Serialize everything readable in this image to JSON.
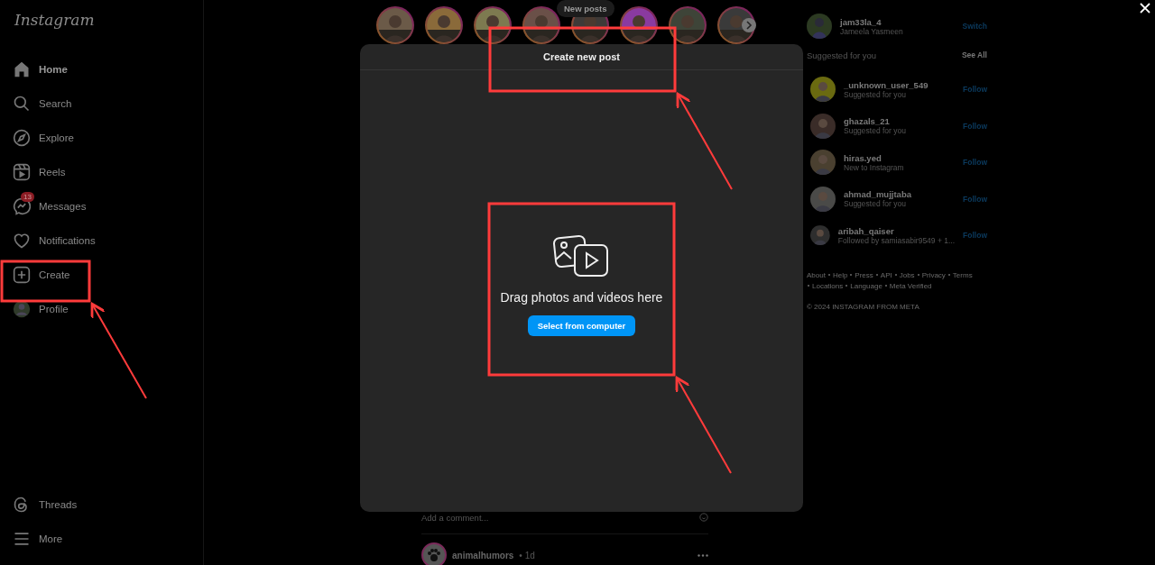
{
  "sidebar": {
    "logo": "Instagram",
    "items": [
      {
        "kind": "home",
        "label": "Home",
        "selected": true
      },
      {
        "kind": "search",
        "label": "Search",
        "selected": false
      },
      {
        "kind": "explore",
        "label": "Explore",
        "selected": false
      },
      {
        "kind": "reels",
        "label": "Reels",
        "selected": false
      },
      {
        "kind": "messages",
        "label": "Messages",
        "selected": false,
        "badge": "13"
      },
      {
        "kind": "notifications",
        "label": "Notifications",
        "selected": false
      },
      {
        "kind": "create",
        "label": "Create",
        "selected": false
      },
      {
        "kind": "profile",
        "label": "Profile",
        "selected": false
      }
    ],
    "bottom_items": [
      {
        "kind": "threads",
        "label": "Threads"
      },
      {
        "kind": "more",
        "label": "More"
      }
    ]
  },
  "feed": {
    "new_posts": "New posts",
    "comment": {
      "placeholder": "Add a comment..."
    },
    "post": {
      "author": "animalhumors",
      "time": "• 1d"
    }
  },
  "account": {
    "username": "jam33la_4",
    "name": "Jameela Yasmeen",
    "action": "Switch"
  },
  "suggestions": {
    "title": "Suggested for you",
    "see_all": "See All",
    "users": [
      {
        "username": "_unknown_user_549",
        "note": "Suggested for you",
        "action": "Follow"
      },
      {
        "username": "ghazals_21",
        "note": "Suggested for you",
        "action": "Follow"
      },
      {
        "username": "hiras.yed",
        "note": "New to Instagram",
        "action": "Follow"
      },
      {
        "username": "ahmad_mujjtaba",
        "note": "Suggested for you",
        "action": "Follow"
      },
      {
        "username": "aribah_qaiser",
        "note": "Followed by samiasabir9549 + 1...",
        "action": "Follow"
      }
    ]
  },
  "footer": {
    "links": [
      "About",
      "Help",
      "Press",
      "API",
      "Jobs",
      "Privacy",
      "Terms",
      "Locations",
      "Language",
      "Meta Verified"
    ],
    "copyright": "© 2024 INSTAGRAM FROM META"
  },
  "modal": {
    "title": "Create new post",
    "prompt": "Drag photos and videos here",
    "button": "Select from computer"
  }
}
